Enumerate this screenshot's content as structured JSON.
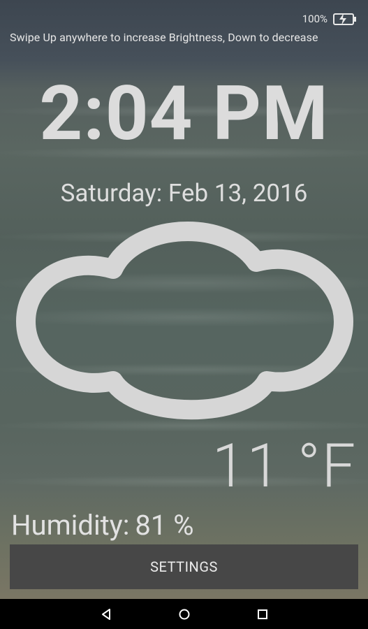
{
  "status": {
    "battery_level": "100%"
  },
  "hint_text": "Swipe Up anywhere to increase Brightness, Down to decrease",
  "clock": {
    "time": "2:04 PM",
    "date": "Saturday: Feb 13, 2016"
  },
  "weather": {
    "icon": "cloud-icon",
    "temperature": "11 °F",
    "humidity_label": "Humidity:",
    "humidity_value": "81 %"
  },
  "settings_label": "SETTINGS",
  "nav": {
    "back": "back-icon",
    "home": "home-icon",
    "recents": "recents-icon"
  }
}
